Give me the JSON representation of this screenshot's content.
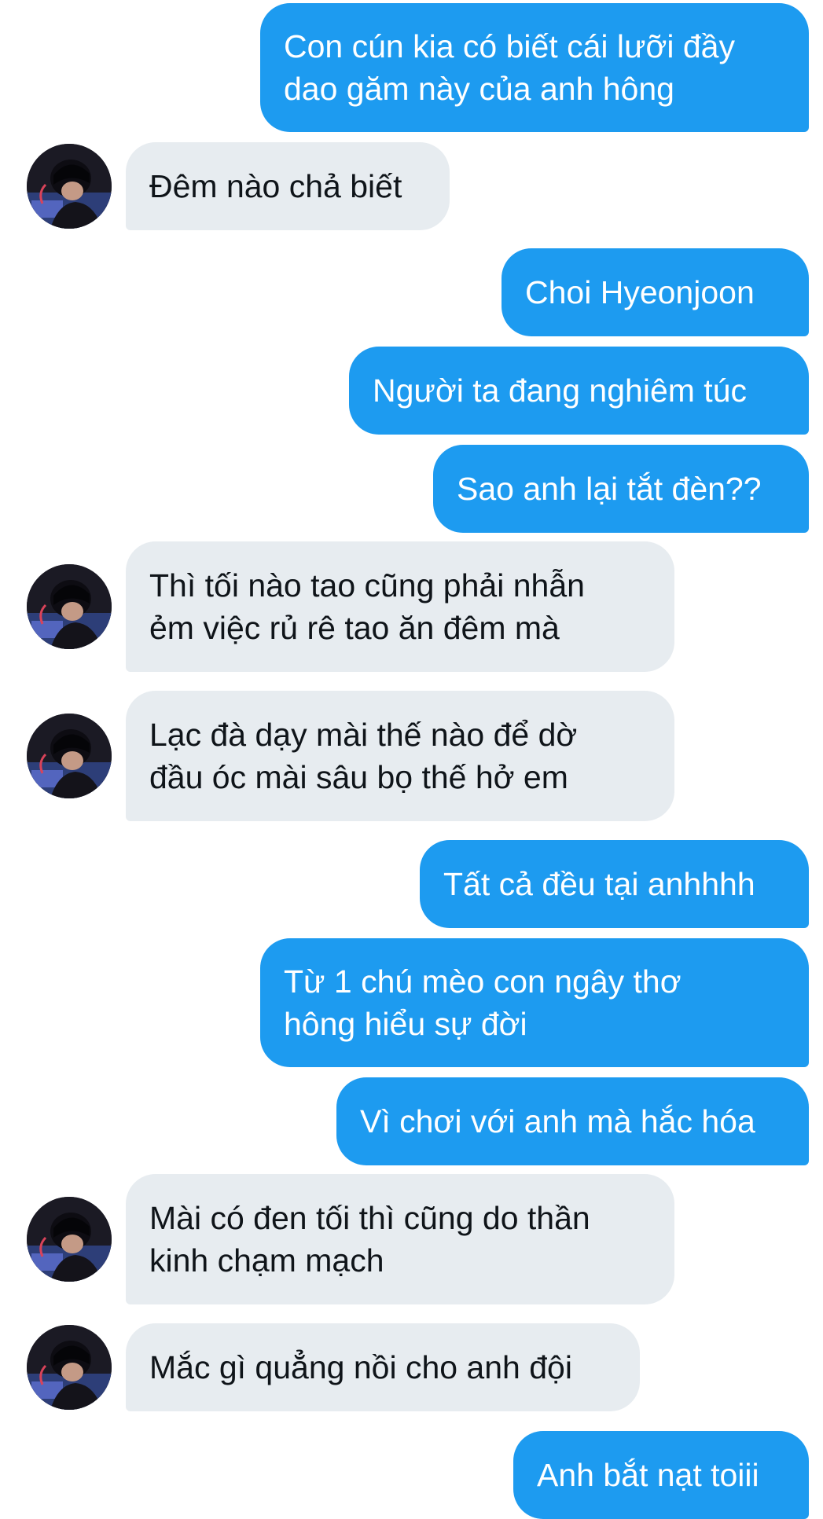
{
  "conversation": {
    "messages": [
      {
        "side": "out",
        "text": "Con cún kia có biết cái lưỡi đầy\ndao găm này của anh hông"
      },
      {
        "side": "in",
        "text": "Đêm nào chả biết",
        "avatar": true
      },
      {
        "side": "out",
        "text": "Choi Hyeonjoon"
      },
      {
        "side": "out",
        "text": "Người ta đang nghiêm túc"
      },
      {
        "side": "out",
        "text": "Sao anh lại tắt đèn??"
      },
      {
        "side": "in",
        "text": "Thì tối nào tao cũng phải nhẫn\nẻm việc rủ rê tao ăn đêm mà",
        "avatar": true
      },
      {
        "side": "in",
        "text": "Lạc đà dạy mài thế nào để dờ\nđầu óc mài sâu bọ thế hở em",
        "avatar": true
      },
      {
        "side": "out",
        "text": "Tất cả đều tại anhhhh"
      },
      {
        "side": "out",
        "text": "Từ 1 chú mèo con ngây thơ\nhông hiểu sự đời"
      },
      {
        "side": "out",
        "text": "Vì chơi với anh mà hắc hóa"
      },
      {
        "side": "in",
        "text": "Mài có đen tối thì cũng do thần\nkinh chạm mạch",
        "avatar": true
      },
      {
        "side": "in",
        "text": "Mắc gì quẳng nồi cho anh đội",
        "avatar": true
      },
      {
        "side": "out",
        "text": "Anh bắt nạt toiii"
      }
    ]
  },
  "colors": {
    "outgoing_bubble": "#1d9bf0",
    "incoming_bubble": "#e7ecf0",
    "background": "#ffffff"
  },
  "icons": {
    "avatar": "profile-photo-avatar"
  }
}
